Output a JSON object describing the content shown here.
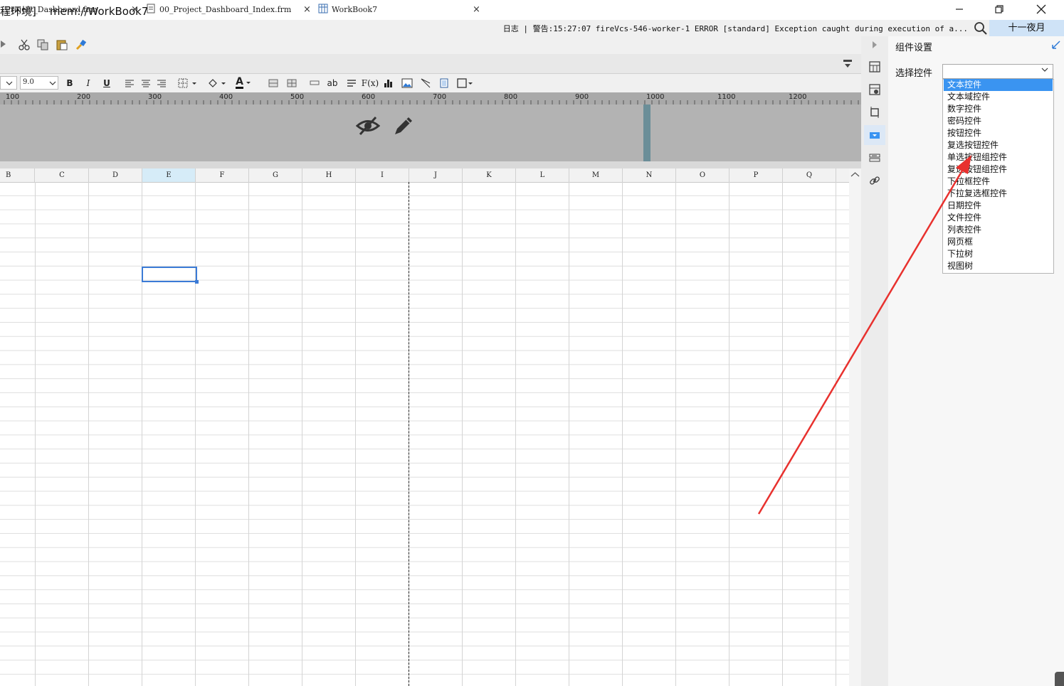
{
  "window": {
    "title": "程环境]    mem://WorkBook7",
    "minimize_icon": "minimize-icon",
    "restore_icon": "restore-icon",
    "close_icon": "close-icon"
  },
  "statusbar": {
    "log": "日志 | 警告:15:27:07 fireVcs-546-worker-1 ERROR [standard] Exception caught during execution of a...",
    "user": "十一夜月"
  },
  "tabs": [
    {
      "label": "_Project_Dashboard.frm",
      "close": "×"
    },
    {
      "label": "00_Project_Dashboard_Index.frm",
      "close": "×"
    },
    {
      "label": "WorkBook7",
      "close": "×"
    }
  ],
  "format_toolbar": {
    "font_size": "9.0",
    "bold": "B",
    "italic": "I",
    "underline": "U",
    "text_color_glyph": "A",
    "ab_glyph": "ab",
    "formula_glyph": "F(x)"
  },
  "ruler": {
    "labels": [
      "100",
      "200",
      "300",
      "400",
      "500",
      "600",
      "700",
      "800",
      "900",
      "1000",
      "1100",
      "1200"
    ]
  },
  "grid": {
    "columns": [
      "B",
      "C",
      "D",
      "E",
      "F",
      "G",
      "H",
      "I",
      "J",
      "K",
      "L",
      "M",
      "N",
      "O",
      "P",
      "Q"
    ],
    "selected_column": "E"
  },
  "panel": {
    "title": "组件设置",
    "select_label": "选择控件",
    "options": [
      "文本控件",
      "文本域控件",
      "数字控件",
      "密码控件",
      "按钮控件",
      "复选按钮控件",
      "单选按钮组控件",
      "复选按钮组控件",
      "下拉框控件",
      "下拉复选框控件",
      "日期控件",
      "文件控件",
      "列表控件",
      "网页框",
      "下拉树",
      "视图树"
    ],
    "selected_option": "文本控件"
  },
  "colors": {
    "accent": "#3a94f1",
    "annotation_arrow": "#e8312e",
    "preview_area": "#b3b3b3"
  }
}
